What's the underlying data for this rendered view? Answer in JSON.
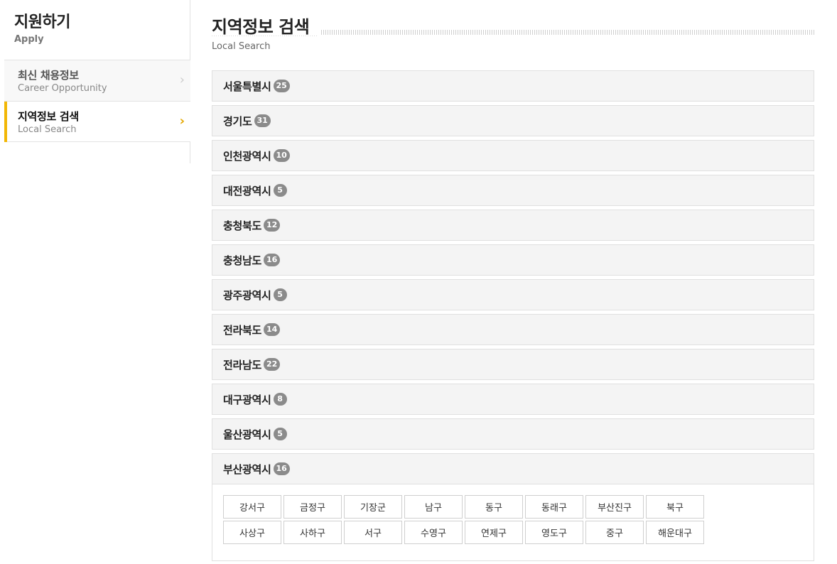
{
  "sidebar": {
    "title": "지원하기",
    "subtitle": "Apply",
    "items": [
      {
        "label": "최신 채용정보",
        "sub": "Career Opportunity",
        "chevron": "›"
      },
      {
        "label": "지역정보 검색",
        "sub": "Local Search",
        "chevron": "›"
      }
    ],
    "accent_color": "#f2b705"
  },
  "main": {
    "title": "지역정보 검색",
    "subtitle": "Local Search",
    "regions": [
      {
        "name": "서울특별시",
        "count": "25"
      },
      {
        "name": "경기도",
        "count": "31"
      },
      {
        "name": "인천광역시",
        "count": "10"
      },
      {
        "name": "대전광역시",
        "count": "5"
      },
      {
        "name": "충청북도",
        "count": "12"
      },
      {
        "name": "충청남도",
        "count": "16"
      },
      {
        "name": "광주광역시",
        "count": "5"
      },
      {
        "name": "전라북도",
        "count": "14"
      },
      {
        "name": "전라남도",
        "count": "22"
      },
      {
        "name": "대구광역시",
        "count": "8"
      },
      {
        "name": "울산광역시",
        "count": "5"
      }
    ],
    "expanded": {
      "name": "부산광역시",
      "count": "16",
      "districts": [
        "강서구",
        "금정구",
        "기장군",
        "남구",
        "동구",
        "동래구",
        "부산진구",
        "북구",
        "사상구",
        "사하구",
        "서구",
        "수영구",
        "연제구",
        "영도구",
        "중구",
        "해운대구"
      ]
    }
  }
}
